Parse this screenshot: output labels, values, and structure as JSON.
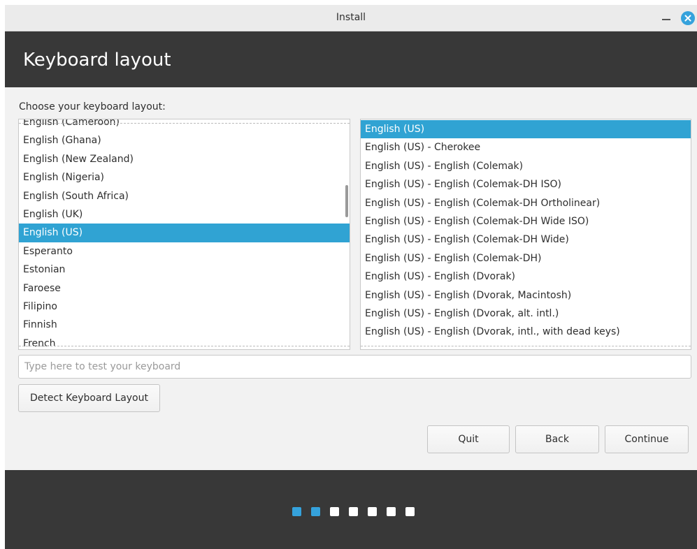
{
  "window": {
    "title": "Install"
  },
  "header": {
    "title": "Keyboard layout"
  },
  "prompt": "Choose your keyboard layout:",
  "layouts": [
    "English (Cameroon)",
    "English (Ghana)",
    "English (New Zealand)",
    "English (Nigeria)",
    "English (South Africa)",
    "English (UK)",
    "English (US)",
    "Esperanto",
    "Estonian",
    "Faroese",
    "Filipino",
    "Finnish",
    "French"
  ],
  "layouts_selected": "English (US)",
  "variants": [
    "English (US)",
    "English (US) - Cherokee",
    "English (US) - English (Colemak)",
    "English (US) - English (Colemak-DH ISO)",
    "English (US) - English (Colemak-DH Ortholinear)",
    "English (US) - English (Colemak-DH Wide ISO)",
    "English (US) - English (Colemak-DH Wide)",
    "English (US) - English (Colemak-DH)",
    "English (US) - English (Dvorak)",
    "English (US) - English (Dvorak, Macintosh)",
    "English (US) - English (Dvorak, alt. intl.)",
    "English (US) - English (Dvorak, intl., with dead keys)"
  ],
  "variants_selected": "English (US)",
  "test_input": {
    "value": "",
    "placeholder": "Type here to test your keyboard"
  },
  "buttons": {
    "detect": "Detect Keyboard Layout",
    "quit": "Quit",
    "back": "Back",
    "continue": "Continue"
  },
  "progress": {
    "total_steps": 7,
    "completed_steps": 2
  },
  "colors": {
    "accent": "#35a2dc",
    "selection": "#30a3d3",
    "header_bg": "#383838"
  }
}
